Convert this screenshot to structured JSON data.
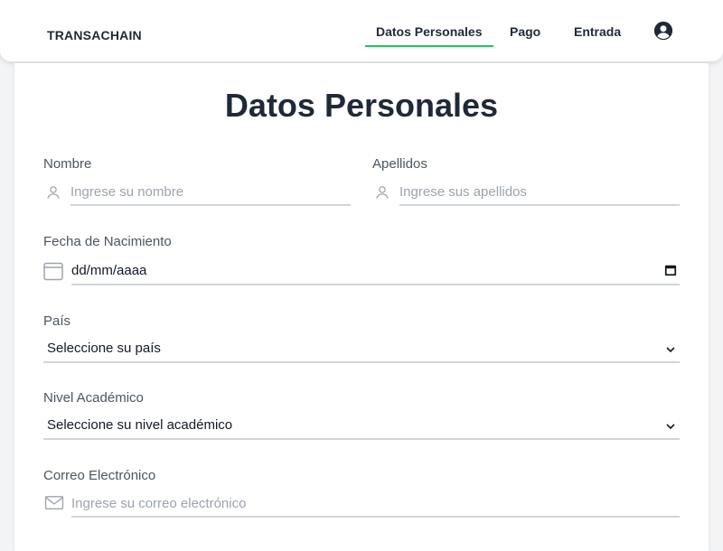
{
  "nav": {
    "brand": "TRANSACHAIN",
    "items": [
      {
        "label": "Datos Personales",
        "active": true
      },
      {
        "label": "Pago",
        "active": false
      },
      {
        "label": "Entrada",
        "active": false
      }
    ],
    "accent_color": "#22c55e"
  },
  "page": {
    "title": "Datos Personales"
  },
  "form": {
    "nombre": {
      "label": "Nombre",
      "placeholder": "Ingrese su nombre",
      "icon": "user-icon"
    },
    "apellidos": {
      "label": "Apellidos",
      "placeholder": "Ingrese sus apellidos",
      "icon": "user-icon"
    },
    "fecha": {
      "label": "Fecha de Nacimiento",
      "value": "dd/mm/aaaa",
      "icon": "calendar-icon"
    },
    "pais": {
      "label": "País",
      "selected": "Seleccione su país"
    },
    "nivel": {
      "label": "Nivel Académico",
      "selected": "Seleccione su nivel académico"
    },
    "correo": {
      "label": "Correo Electrónico",
      "placeholder": "Ingrese su correo electrónico",
      "icon": "mail-icon"
    }
  }
}
